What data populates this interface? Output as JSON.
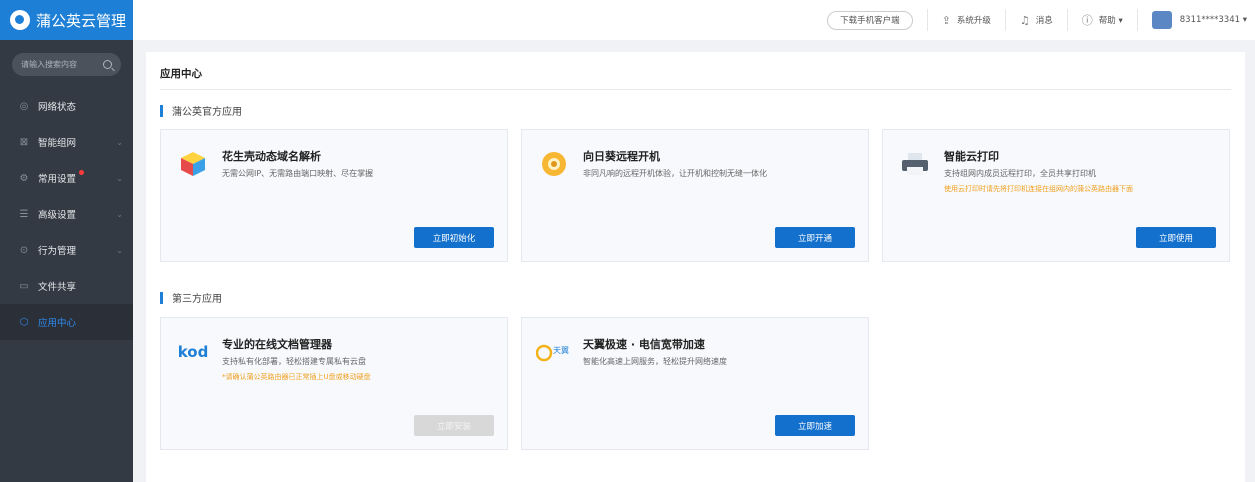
{
  "app": {
    "title": "蒲公英云管理"
  },
  "search": {
    "placeholder": "请输入搜索内容"
  },
  "sidebar": {
    "items": [
      {
        "label": "网络状态"
      },
      {
        "label": "智能组网"
      },
      {
        "label": "常用设置"
      },
      {
        "label": "高级设置"
      },
      {
        "label": "行为管理"
      },
      {
        "label": "文件共享"
      },
      {
        "label": "应用中心"
      }
    ]
  },
  "topbar": {
    "download": "下载手机客户端",
    "upgrade": "系统升级",
    "messages": "消息",
    "help": "帮助 ▾",
    "user": "8311****3341 ▾"
  },
  "page": {
    "title": "应用中心"
  },
  "sections": {
    "official": "蒲公英官方应用",
    "third_party": "第三方应用"
  },
  "apps": [
    {
      "title": "花生壳动态域名解析",
      "desc": "无需公网IP、无需路由端口映射、尽在掌握",
      "warn": "",
      "button": "立即初始化"
    },
    {
      "title": "向日葵远程开机",
      "desc": "非同凡响的远程开机体验，让开机和控制无缝一体化",
      "warn": "",
      "button": "立即开通"
    },
    {
      "title": "智能云打印",
      "desc": "支持组网内成员远程打印，全员共享打印机",
      "warn": "使用云打印时请先将打印机连接在组网内的蒲公英路由器下面",
      "button": "立即使用"
    },
    {
      "title": "专业的在线文档管理器",
      "desc": "支持私有化部署，轻松搭建专属私有云盘",
      "warn": "*请确认蒲公英路由器已正常插上U盘或移动硬盘",
      "button": "立即安装"
    },
    {
      "title": "天翼极速 · 电信宽带加速",
      "desc": "智能化高速上网服务，轻松提升网络速度",
      "warn": "",
      "button": "立即加速"
    }
  ],
  "logos": {
    "kod": "kod",
    "tianyi": "天翼"
  },
  "colors": {
    "accent": "#1370cc",
    "warning": "#f0a020",
    "sidebar": "#343a44"
  }
}
